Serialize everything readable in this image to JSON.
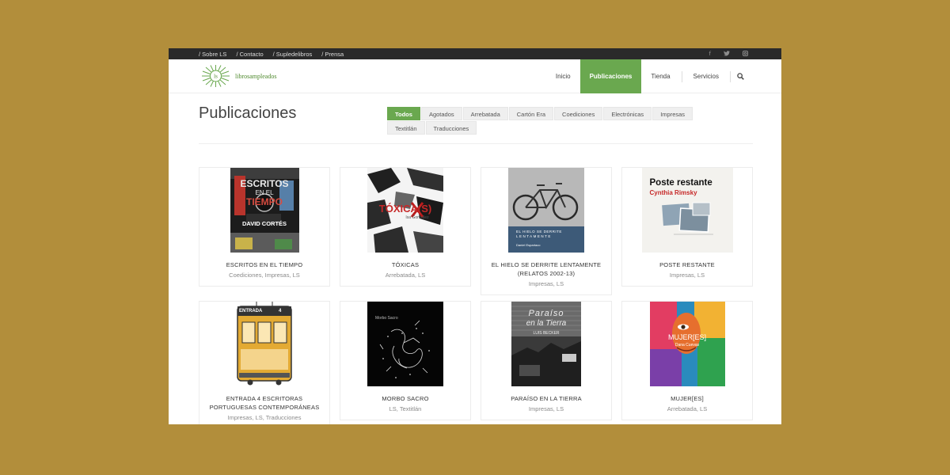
{
  "topbar": {
    "links": [
      "/ Sobre LS",
      "/ Contacto",
      "/ Supledelibros",
      "/ Prensa"
    ],
    "social_icons": [
      "facebook-icon",
      "twitter-icon",
      "instagram-icon"
    ]
  },
  "brand": {
    "logo_mark": "ls",
    "name": "librosampleados"
  },
  "nav": {
    "items": [
      "Inicio",
      "Publicaciones",
      "Tienda",
      "Servicios"
    ],
    "active": "Publicaciones"
  },
  "page": {
    "title": "Publicaciones"
  },
  "filters": {
    "items": [
      "Todos",
      "Agotados",
      "Arrebatada",
      "Cartón Era",
      "Coediciones",
      "Electrónicas",
      "Impresas",
      "Textitlán",
      "Traducciones"
    ],
    "active": "Todos"
  },
  "books": [
    {
      "title": "ESCRITOS EN EL TIEMPO",
      "categories": "Coediciones, Impresas, LS",
      "cover_text": [
        "ESCRITOS",
        "EN EL",
        "TIEMPO",
        "DAVID CORTÉS"
      ]
    },
    {
      "title": "TÓXICAS",
      "categories": "Arrebatada, LS",
      "cover_text": [
        "TÓXICA(S)",
        "Isa Gonzalez"
      ]
    },
    {
      "title": "EL HIELO SE DERRITE LENTAMENTE (RELATOS 2002-13)",
      "categories": "Impresas, LS",
      "cover_text": [
        "EL HIELO SE DERRITE",
        "LENTAMENTE",
        "Daniel Espartaco"
      ]
    },
    {
      "title": "POSTE RESTANTE",
      "categories": "Impresas, LS",
      "cover_text": [
        "Poste restante",
        "Cynthia Rimsky"
      ]
    },
    {
      "title": "ENTRADA 4 ESCRITORAS PORTUGUESAS CONTEMPORÁNEAS",
      "categories": "Impresas, LS, Traducciones",
      "cover_text": [
        "ENTRADA",
        "4"
      ]
    },
    {
      "title": "MORBO SACRO",
      "categories": "LS, Textitlán",
      "cover_text": [
        "Morbo Sacro"
      ]
    },
    {
      "title": "PARAÍSO EN LA TIERRA",
      "categories": "Impresas, LS",
      "cover_text": [
        "Paraíso",
        "en la Tierra",
        "LUIS BECKER"
      ]
    },
    {
      "title": "MUJER[ES]",
      "categories": "Arrebatada, LS",
      "cover_text": [
        "MUJER[ES]",
        "Dana Cuevas"
      ]
    }
  ],
  "colors": {
    "accent": "#6aa84f",
    "background": "#b28e3b",
    "topbar": "#2a2a2a"
  }
}
